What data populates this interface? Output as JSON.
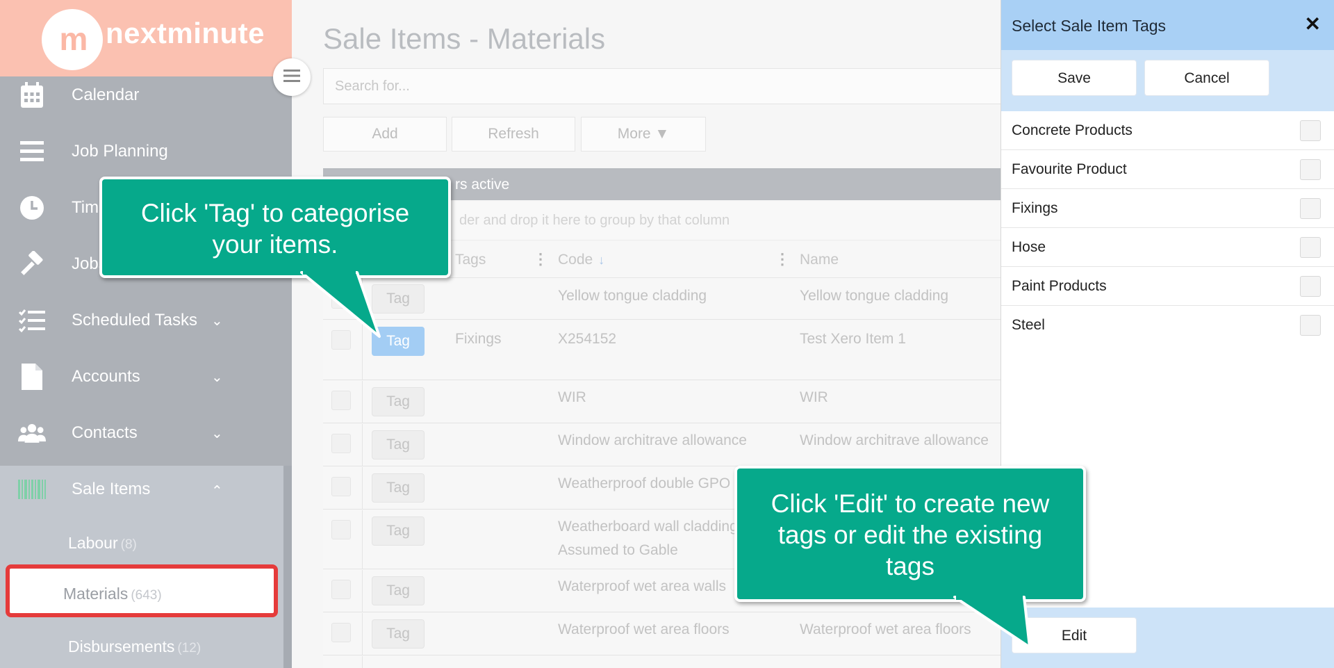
{
  "app": {
    "logo_mark": "m",
    "logo_text": "nextminute",
    "brand_color": "#fbc1b1",
    "accent_color": "#06a98b"
  },
  "sidebar": {
    "items": [
      {
        "label": "Calendar",
        "icon": "calendar-icon"
      },
      {
        "label": "Job Planning",
        "icon": "list-icon"
      },
      {
        "label": "Timesheets",
        "icon": "clock-icon"
      },
      {
        "label": "Jobs",
        "icon": "hammer-icon"
      },
      {
        "label": "Scheduled Tasks",
        "icon": "checklist-icon",
        "expandable": true
      },
      {
        "label": "Accounts",
        "icon": "document-icon",
        "expandable": true
      },
      {
        "label": "Contacts",
        "icon": "people-icon",
        "expandable": true
      },
      {
        "label": "Sale Items",
        "icon": "barcode-icon",
        "expanded": true
      }
    ],
    "sub_items": [
      {
        "label": "Labour",
        "count": "(8)"
      },
      {
        "label": "Materials",
        "count": "(643)",
        "selected": true
      },
      {
        "label": "Disbursements",
        "count": "(12)"
      }
    ]
  },
  "main": {
    "title": "Sale Items - Materials",
    "search_placeholder": "Search for...",
    "buttons": {
      "add": "Add",
      "refresh": "Refresh",
      "more": "More ▼"
    },
    "filters_text": "rs active",
    "group_hint": "der and drop it here to group by that column",
    "columns": {
      "tags": "Tags",
      "code": "Code",
      "name": "Name"
    },
    "sort_indicator": "↓",
    "tag_button_label": "Tag",
    "rows": [
      {
        "tags": "",
        "code": "Yellow tongue cladding",
        "name": "Yellow tongue cladding"
      },
      {
        "tags": "Fixings",
        "code": "X254152",
        "name": "Test Xero Item 1",
        "active": true
      },
      {
        "tags": "",
        "code": "WIR",
        "name": "WIR"
      },
      {
        "tags": "",
        "code": "Window architrave allowance",
        "name": "Window architrave allowance"
      },
      {
        "tags": "",
        "code": "Weatherproof double GPO",
        "name": ""
      },
      {
        "tags": "",
        "code": "Weatherboard wall cladding",
        "code2": "Assumed to Gable",
        "name": ""
      },
      {
        "tags": "",
        "code": "Waterproof wet area walls",
        "name": ""
      },
      {
        "tags": "",
        "code": "Waterproof wet area floors",
        "name": "Waterproof wet area floors"
      }
    ]
  },
  "panel": {
    "title": "Select Sale Item Tags",
    "close": "✕",
    "save": "Save",
    "cancel": "Cancel",
    "edit": "Edit",
    "tags": [
      "Concrete Products",
      "Favourite Product",
      "Fixings",
      "Hose",
      "Paint Products",
      "Steel"
    ]
  },
  "callouts": {
    "tag": "Click 'Tag' to categorise your items.",
    "edit": "Click 'Edit' to create new tags or edit the existing tags"
  }
}
